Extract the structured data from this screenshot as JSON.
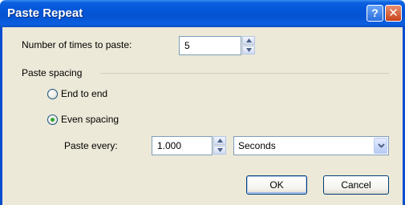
{
  "window": {
    "title": "Paste Repeat",
    "help_glyph": "?",
    "close_glyph": "✕"
  },
  "repeat": {
    "label": "Number of times to paste:",
    "value": "5"
  },
  "spacing": {
    "group_label": "Paste spacing",
    "option_end_to_end": "End to end",
    "option_even": "Even spacing",
    "selected": "even"
  },
  "paste_every": {
    "label": "Paste every:",
    "value": "1.000",
    "unit_selected": "Seconds"
  },
  "buttons": {
    "ok": "OK",
    "cancel": "Cancel"
  },
  "icons": {
    "spin": "spin-up-down-icon",
    "dropdown": "chevron-down-icon"
  },
  "colors": {
    "titlebar": "#0454d6",
    "dialog_bg": "#ece9d8",
    "radio_selected": "#2fa52f",
    "border_accent": "#7f9db9"
  }
}
